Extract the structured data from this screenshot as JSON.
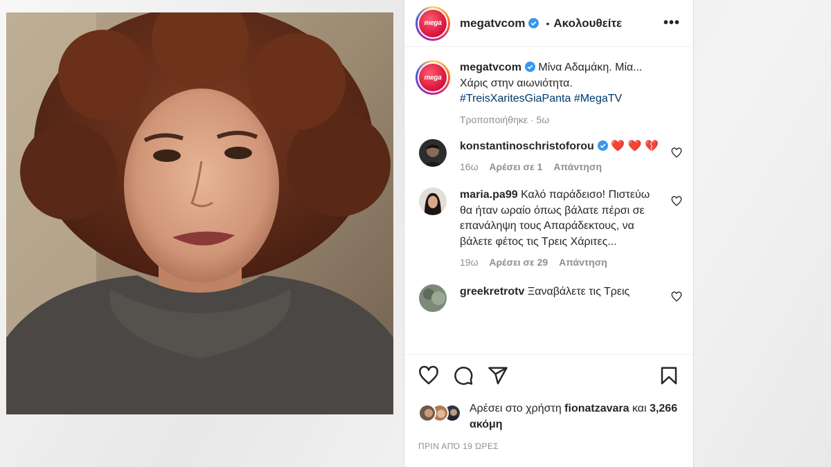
{
  "post": {
    "username": "megatvcom",
    "follow_state": "Ακολουθείτε",
    "avatar_text": "mega",
    "more_label": "•••",
    "dot": "•"
  },
  "caption": {
    "username": "megatvcom",
    "text": "Μίνα Αδαμάκη. Μία... Χάρις στην αιωνιότητα.",
    "hashtags": "#TreisXaritesGiaPanta #MegaTV",
    "meta_edited": "Τροποποιήθηκε",
    "meta_time": "· 5ω"
  },
  "comments": [
    {
      "username": "konstantinoschristoforou",
      "text": "❤️ ❤️ 💔",
      "time": "16ω",
      "likes": "Αρέσει σε 1",
      "reply": "Απάντηση"
    },
    {
      "username": "maria.pa99",
      "text": "Καλό παράδεισο! Πιστεύω θα ήταν ωραίο όπως βάλατε πέρσι σε επανάληψη τους Απαράδεκτους, να βάλετε φέτος τις Τρεις Χάριτες...",
      "time": "19ω",
      "likes": "Αρέσει σε 29",
      "reply": "Απάντηση"
    },
    {
      "username": "greekretrotv",
      "text": "Ξαναβάλετε τις Τρεις"
    }
  ],
  "likes": {
    "prefix": "Αρέσει στο χρήστη",
    "user": "fionatzavara",
    "conj": "και",
    "count": "3,266 ακόμη"
  },
  "timestamp": "ΠΡΙΝ ΑΠΌ 19 ΏΡΕΣ",
  "colors": {
    "verified": "#3897f0",
    "hashtag": "#00376b",
    "muted": "#8e8e8e",
    "mega_red": "#d6123a"
  }
}
